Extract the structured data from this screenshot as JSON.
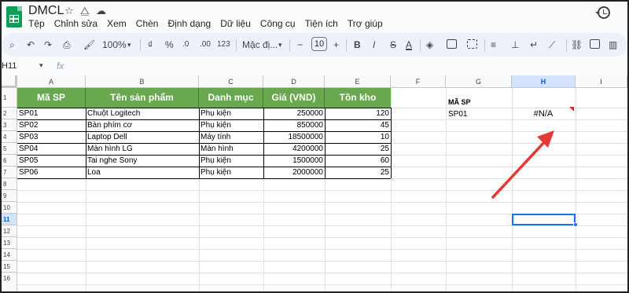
{
  "app": {
    "title": "DMCL",
    "menu": [
      "Tệp",
      "Chỉnh sửa",
      "Xem",
      "Chèn",
      "Định dạng",
      "Dữ liệu",
      "Công cụ",
      "Tiện ích",
      "Trợ giúp"
    ]
  },
  "toolbar": {
    "zoom": "100%",
    "percent": "%",
    "decimal_dec": ".0",
    "decimal_inc": ".00",
    "number_format": "123",
    "font": "Mặc đị...",
    "font_size": "10",
    "minus": "−",
    "plus": "+",
    "bold": "B",
    "italic": "I",
    "strike": "S",
    "text_color": "A",
    "currency": "₫"
  },
  "formula_bar": {
    "cell_ref": "H11",
    "fx": "fx",
    "content": ""
  },
  "columns": [
    "A",
    "B",
    "C",
    "D",
    "E",
    "F",
    "G",
    "H",
    "I"
  ],
  "rows": [
    "1",
    "2",
    "3",
    "4",
    "5",
    "6",
    "7",
    "8",
    "9",
    "10",
    "11",
    "12",
    "13",
    "14",
    "15",
    "16"
  ],
  "selected_column": "H",
  "selected_row": "11",
  "table": {
    "headers": [
      "Mã SP",
      "Tên sản phẩm",
      "Danh mục",
      "Giá (VND)",
      "Tồn kho"
    ],
    "rows": [
      [
        "SP01",
        "Chuột Logitech",
        "Phụ kiện",
        "250000",
        "120"
      ],
      [
        "SP02",
        "Bàn phím cơ",
        "Phụ kiện",
        "850000",
        "45"
      ],
      [
        "SP03",
        "Laptop Dell",
        "Máy tính",
        "18500000",
        "10"
      ],
      [
        "SP04",
        "Màn hình LG",
        "Màn hình",
        "4200000",
        "25"
      ],
      [
        "SP05",
        "Tai nghe Sony",
        "Phụ kiện",
        "1500000",
        "60"
      ],
      [
        "SP06",
        "Loa",
        "Phụ kiện",
        "2000000",
        "25"
      ]
    ]
  },
  "lookup": {
    "label": "MÃ SP",
    "input": "SP01",
    "result": "#N/A"
  },
  "colors": {
    "header_green": "#6aa84f",
    "selection_blue": "#1a73e8",
    "arrow_red": "#e53935"
  }
}
